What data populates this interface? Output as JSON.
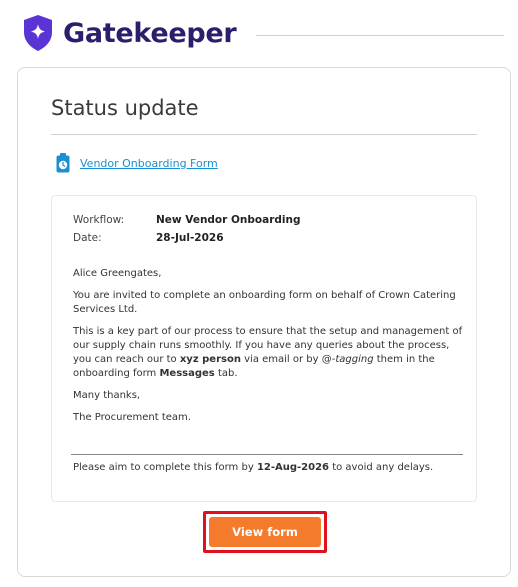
{
  "header": {
    "brand_name": "Gatekeeper",
    "logo_icon": "shield-star-icon",
    "logo_color": "#5b34d6"
  },
  "card": {
    "title": "Status update",
    "form_link": {
      "icon": "clipboard-clock-icon",
      "label": "Vendor Onboarding Form",
      "color": "#1a8fd1"
    },
    "meta": {
      "workflow_label": "Workflow:",
      "workflow_value": "New Vendor Onboarding",
      "date_label": "Date:",
      "date_value": "28-Jul-2026"
    },
    "greeting": "Alice Greengates,",
    "paragraph1": "You are invited to complete an onboarding form on behalf of Crown Catering Services Ltd.",
    "paragraph2": {
      "part1": "This is a key part of our process to ensure that the setup and management of our supply chain runs smoothly. If you have any queries about the process, you can reach our to ",
      "bold1": "xyz person",
      "part2": " via email or by @-",
      "italic1": "tagging",
      "part3": " them in the onboarding form ",
      "bold2": "Messages",
      "part4": " tab."
    },
    "signoff": "Many thanks,",
    "signature": "The Procurement team.",
    "deadline": {
      "prefix": "Please aim to complete this form by ",
      "date": "12-Aug-2026",
      "suffix": " to avoid any delays."
    },
    "button": {
      "label": "View form",
      "color": "#f47a2c",
      "highlight_color": "#e0101e"
    }
  }
}
